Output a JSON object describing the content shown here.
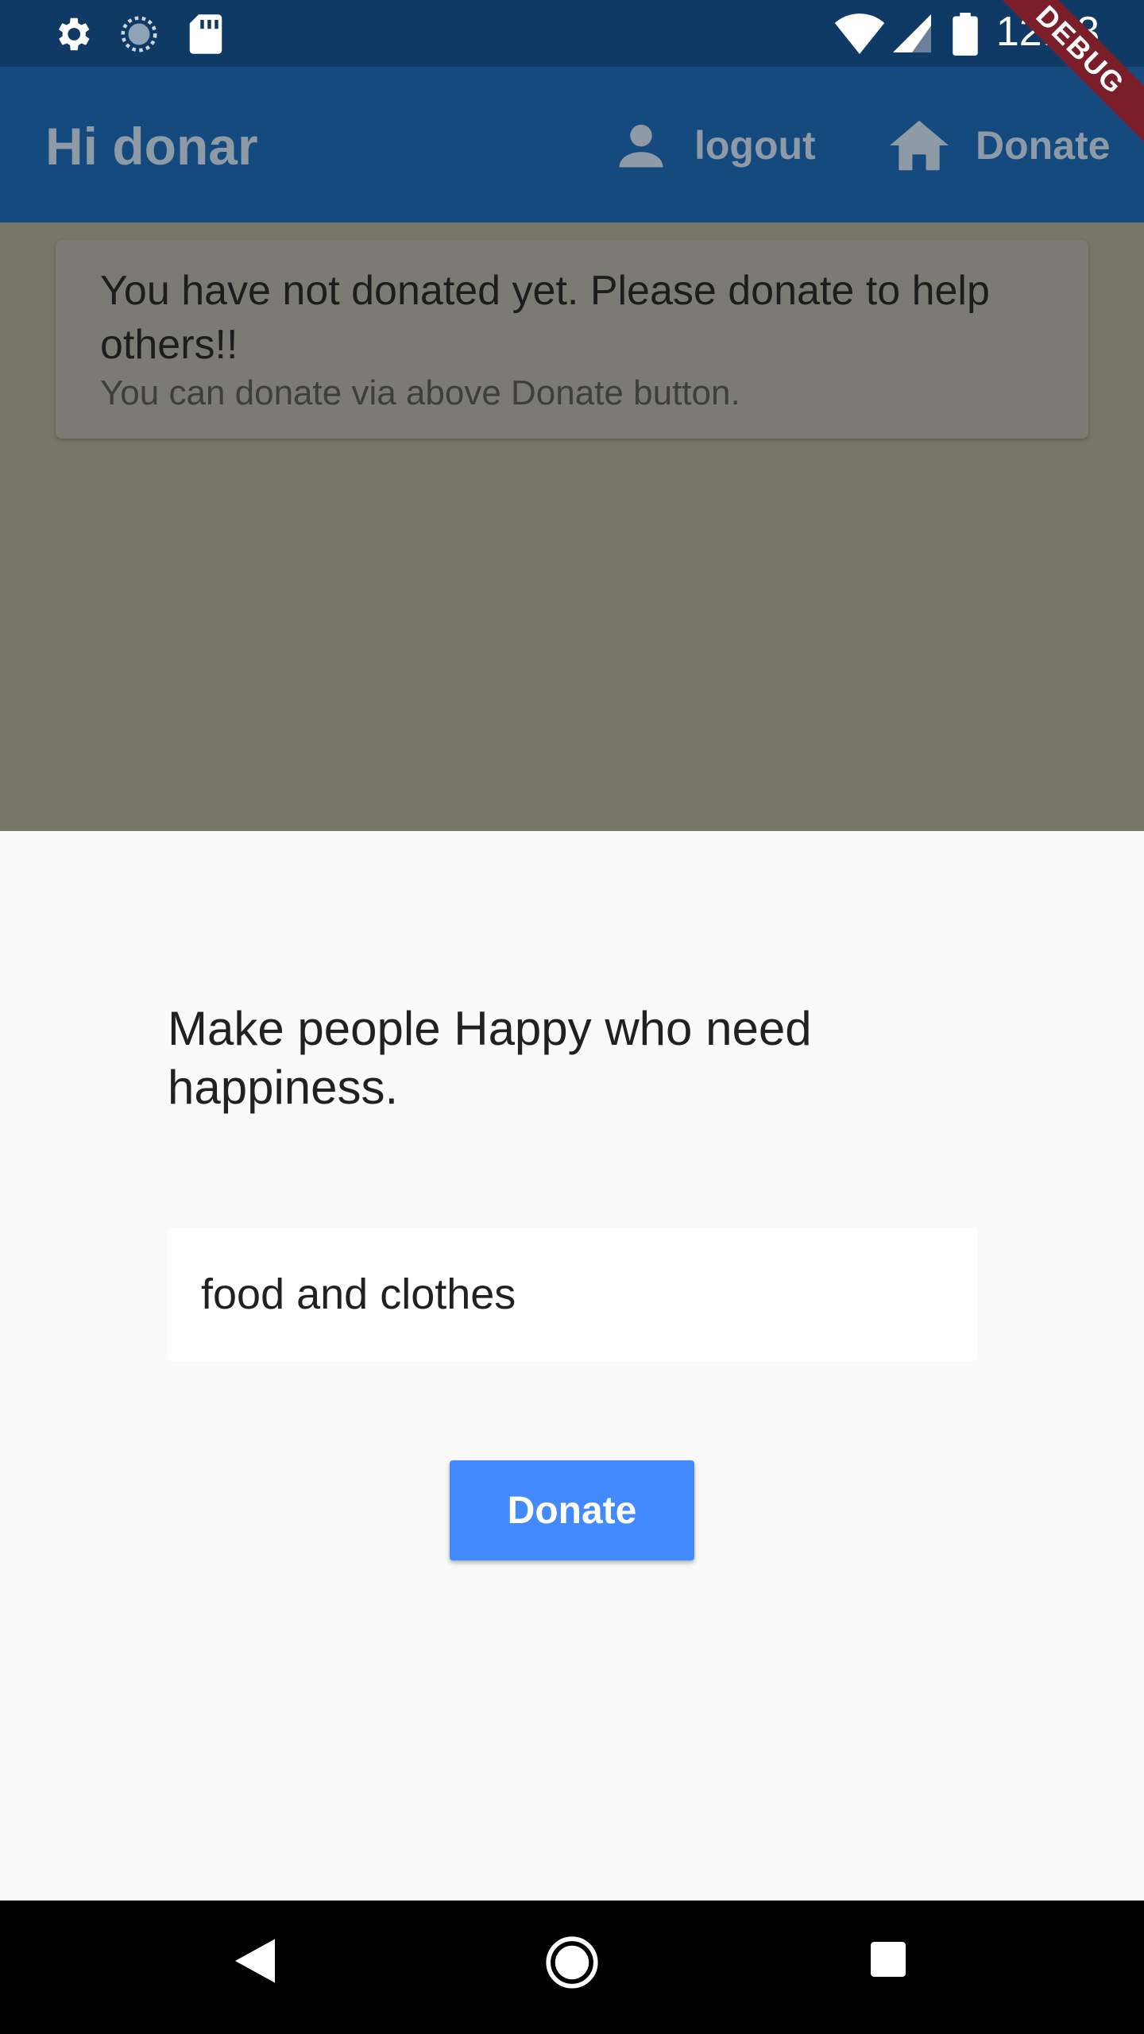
{
  "status_bar": {
    "time": "12:53",
    "icons": [
      "gear-icon",
      "sync-icon",
      "sd-card-icon",
      "wifi-icon",
      "signal-icon",
      "battery-icon"
    ]
  },
  "debug_banner": "DEBUG",
  "app_bar": {
    "title": "Hi donar",
    "actions": [
      {
        "icon": "person-icon",
        "label": "logout"
      },
      {
        "icon": "home-icon",
        "label": "Donate"
      }
    ]
  },
  "notice": {
    "title": "You have not donated yet. Please donate to help others!!",
    "subtitle": "You can donate via above Donate button."
  },
  "sheet": {
    "heading": "Make people Happy who need happiness.",
    "input_value": "food and clothes",
    "button_label": "Donate"
  },
  "nav_bar": {
    "buttons": [
      "back-icon",
      "home-circle-icon",
      "recents-icon"
    ]
  },
  "colors": {
    "status_bar": "#0f3a66",
    "app_bar": "#144a7d",
    "accent_button": "#448aff",
    "scrim": "#79776a",
    "debug_banner": "#7a1f2a"
  }
}
